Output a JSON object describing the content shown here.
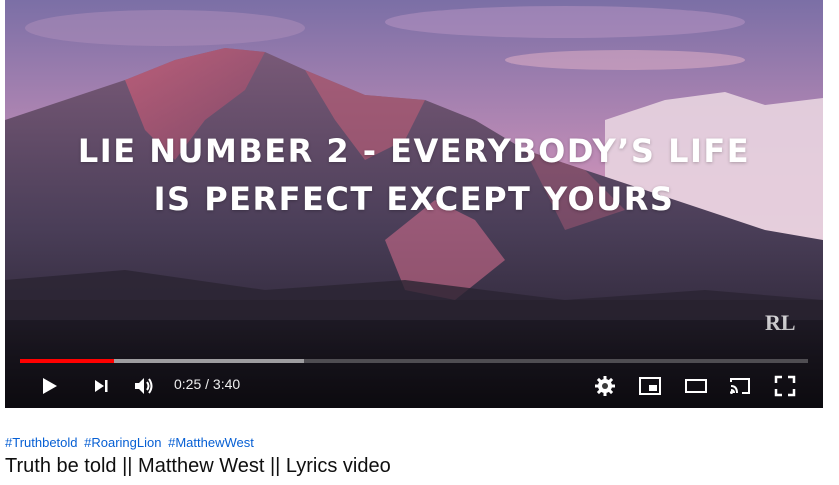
{
  "player": {
    "lyric_line1": "LIE NUMBER 2 - EVERYBODY’S LIFE",
    "lyric_line2": "IS PERFECT EXCEPT YOURS",
    "watermark": "RL",
    "progress_played": 0.119,
    "progress_buffered": 0.36,
    "time_display": "0:25 / 3:40",
    "accent_color": "#ff0000",
    "icons": {
      "play": "play-icon",
      "next": "next-icon",
      "volume": "volume-icon",
      "settings": "gear-icon",
      "miniplayer": "miniplayer-icon",
      "theater": "theater-icon",
      "cast": "cast-icon",
      "fullscreen": "fullscreen-icon"
    }
  },
  "info": {
    "hashtags": [
      "#Truthbetold",
      "#RoaringLion",
      "#MatthewWest"
    ],
    "title": "Truth be told || Matthew West || Lyrics video",
    "link_color": "#065fd4"
  }
}
